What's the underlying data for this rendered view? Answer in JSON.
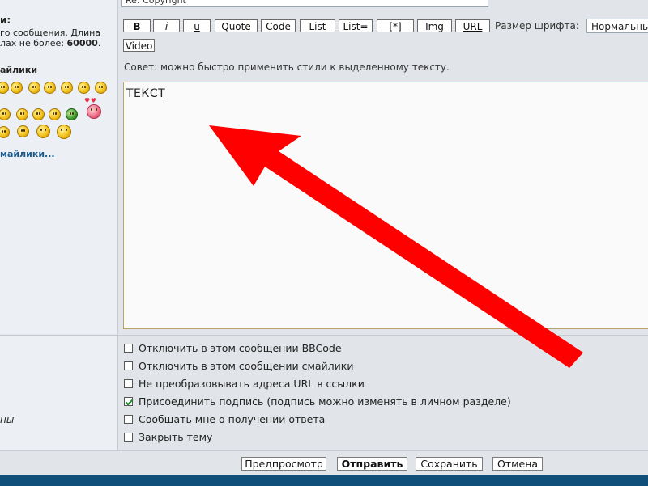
{
  "sidebar": {
    "title_fragment": "и:",
    "length_line1": "го сообщения. Длина",
    "length_line2_prefix": "лах не более: ",
    "length_max": "60000",
    "length_suffix": ".",
    "smileys_title": "айлики",
    "more_smileys": "майлики...",
    "options_fragment": "ны"
  },
  "subject": {
    "value": "Re: Copyright"
  },
  "toolbar": {
    "bold": "B",
    "italic": "i",
    "underline": "u",
    "quote": "Quote",
    "code": "Code",
    "list": "List",
    "list_eq": "List=",
    "list_item": "[*]",
    "img": "Img",
    "url": "URL",
    "video": "Video",
    "font_size_label": "Размер шрифта:",
    "font_size_value": "Нормальный"
  },
  "tip": "Совет: можно быстро применить стили к выделенному тексту.",
  "editor": {
    "text": "ТЕКСТ"
  },
  "options": [
    {
      "label": "Отключить в этом сообщении BBCode",
      "checked": false
    },
    {
      "label": "Отключить в этом сообщении смайлики",
      "checked": false
    },
    {
      "label": "Не преобразовывать адреса URL в ссылки",
      "checked": false
    },
    {
      "label": "Присоединить подпись (подпись можно изменять в личном разделе)",
      "checked": true
    },
    {
      "label": "Сообщать мне о получении ответа",
      "checked": false
    },
    {
      "label": "Закрыть тему",
      "checked": false
    }
  ],
  "footer": {
    "preview": "Предпросмотр",
    "submit": "Отправить",
    "save": "Сохранить",
    "cancel": "Отмена"
  },
  "colors": {
    "arrow": "#ff0000",
    "checkmark": "#1b8a2a",
    "bottom_strip": "#0f4f79"
  }
}
